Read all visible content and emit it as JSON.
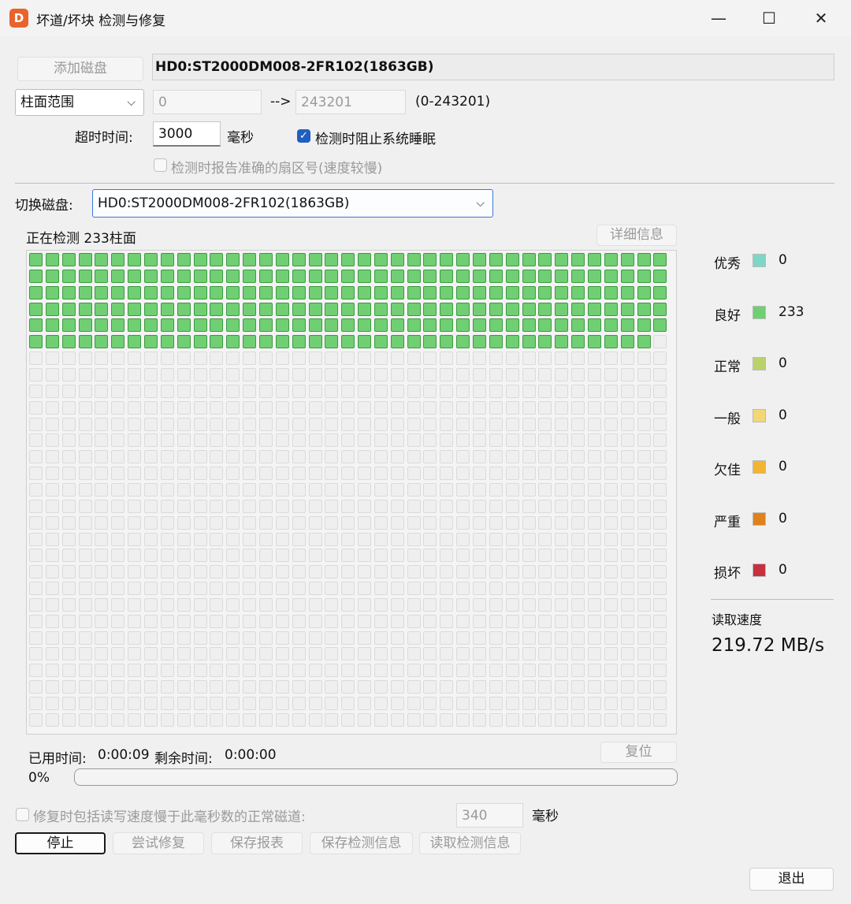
{
  "window": {
    "title": "坏道/坏块 检测与修复",
    "logo_glyph": "D",
    "minimize_glyph": "—",
    "maximize_glyph": "☐",
    "close_glyph": "✕"
  },
  "top": {
    "add_disk_label": "添加磁盘",
    "disk_name": "HD0:ST2000DM008-2FR102(1863GB)",
    "range_mode": "柱面范围",
    "range_start": "0",
    "range_arrow": "-->",
    "range_end": "243201",
    "range_hint": "(0-243201)",
    "timeout_label": "超时时间:",
    "timeout_value": "3000",
    "timeout_unit": "毫秒",
    "prevent_sleep_label": "检测时阻止系统睡眠",
    "prevent_sleep_checked": true,
    "report_sector_label": "检测时报告准确的扇区号(速度较慢)",
    "report_sector_checked": false
  },
  "switch": {
    "label": "切换磁盘:",
    "selected": "HD0:ST2000DM008-2FR102(1863GB)"
  },
  "scan": {
    "status_text": "正在检测 233柱面",
    "details_label": "详细信息",
    "grid_columns": 39,
    "grid_rows": 29,
    "cells_good": 233
  },
  "legend": [
    {
      "label": "优秀",
      "color": "#7ed6c6",
      "count": "0"
    },
    {
      "label": "良好",
      "color": "#6fcf72",
      "count": "233"
    },
    {
      "label": "正常",
      "color": "#b9d36a",
      "count": "0"
    },
    {
      "label": "一般",
      "color": "#f1d776",
      "count": "0"
    },
    {
      "label": "欠佳",
      "color": "#f2b531",
      "count": "0"
    },
    {
      "label": "严重",
      "color": "#e08219",
      "count": "0"
    },
    {
      "label": "损坏",
      "color": "#c6303f",
      "count": "0"
    }
  ],
  "speed": {
    "label": "读取速度",
    "value": "219.72 MB/s"
  },
  "time": {
    "elapsed_label": "已用时间:",
    "elapsed_value": "0:00:09",
    "remaining_label": "剩余时间:",
    "remaining_value": "0:00:00",
    "reset_label": "复位"
  },
  "progress": {
    "percent_text": "0%",
    "fraction": 0
  },
  "repair": {
    "slow_track_label": "修复时包括读写速度慢于此毫秒数的正常磁道:",
    "slow_track_checked": false,
    "slow_track_value": "340",
    "slow_track_unit": "毫秒"
  },
  "actions": {
    "stop": "停止",
    "try_repair": "尝试修复",
    "save_report": "保存报表",
    "save_info": "保存检测信息",
    "load_info": "读取检测信息",
    "exit": "退出"
  }
}
